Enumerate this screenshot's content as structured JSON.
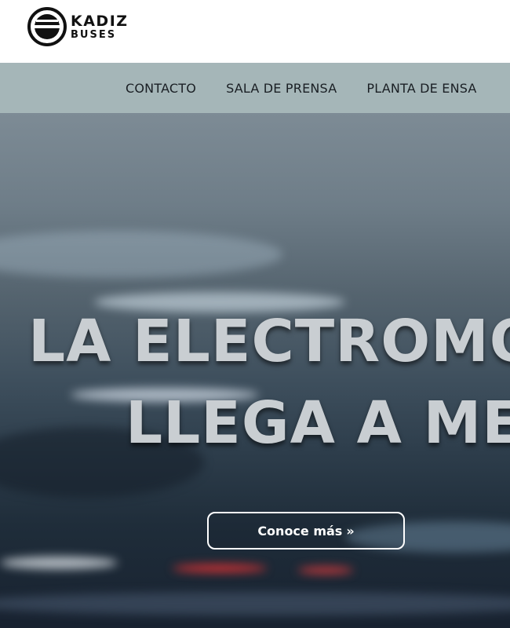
{
  "header": {
    "logo_line1": "KADIZ",
    "logo_line2": "BUSES"
  },
  "nav": {
    "items": [
      "CONTACTO",
      "SALA DE PRENSA",
      "PLANTA DE ENSA"
    ]
  },
  "hero": {
    "headline_line1": "LA ELECTROMOV",
    "headline_line2": "LLEGA A MEX",
    "cta_label": "Conoce más",
    "cta_chevron": "»"
  },
  "colors": {
    "nav_bg": "#a5b6b8",
    "headline": "#c9ced2",
    "cta_border": "#ffffff"
  }
}
